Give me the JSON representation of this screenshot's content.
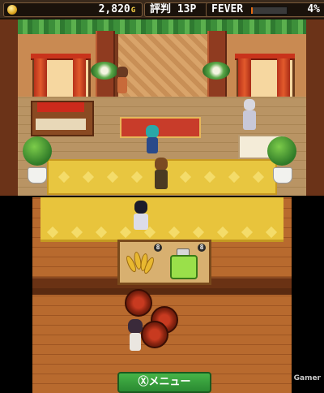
{
  "hud": {
    "gold_value": "2,820",
    "gold_unit": "G",
    "reputation_label": "評判",
    "reputation_value": "13P",
    "fever_label": "FEVER",
    "fever_level": 0.04,
    "fever_percent": "4%"
  },
  "shop_shelf": {
    "items": [
      {
        "icon": "wheat-icon",
        "count": "8"
      },
      {
        "icon": "green-bottle-icon",
        "count": "8"
      }
    ]
  },
  "menu_button": {
    "label": "Ⓧメニュー"
  },
  "watermark": {
    "text": "Gamer"
  },
  "colors": {
    "carpet": "#e8c640",
    "menu_button": "#2a8a32",
    "fever_fill": "#e86a10"
  }
}
